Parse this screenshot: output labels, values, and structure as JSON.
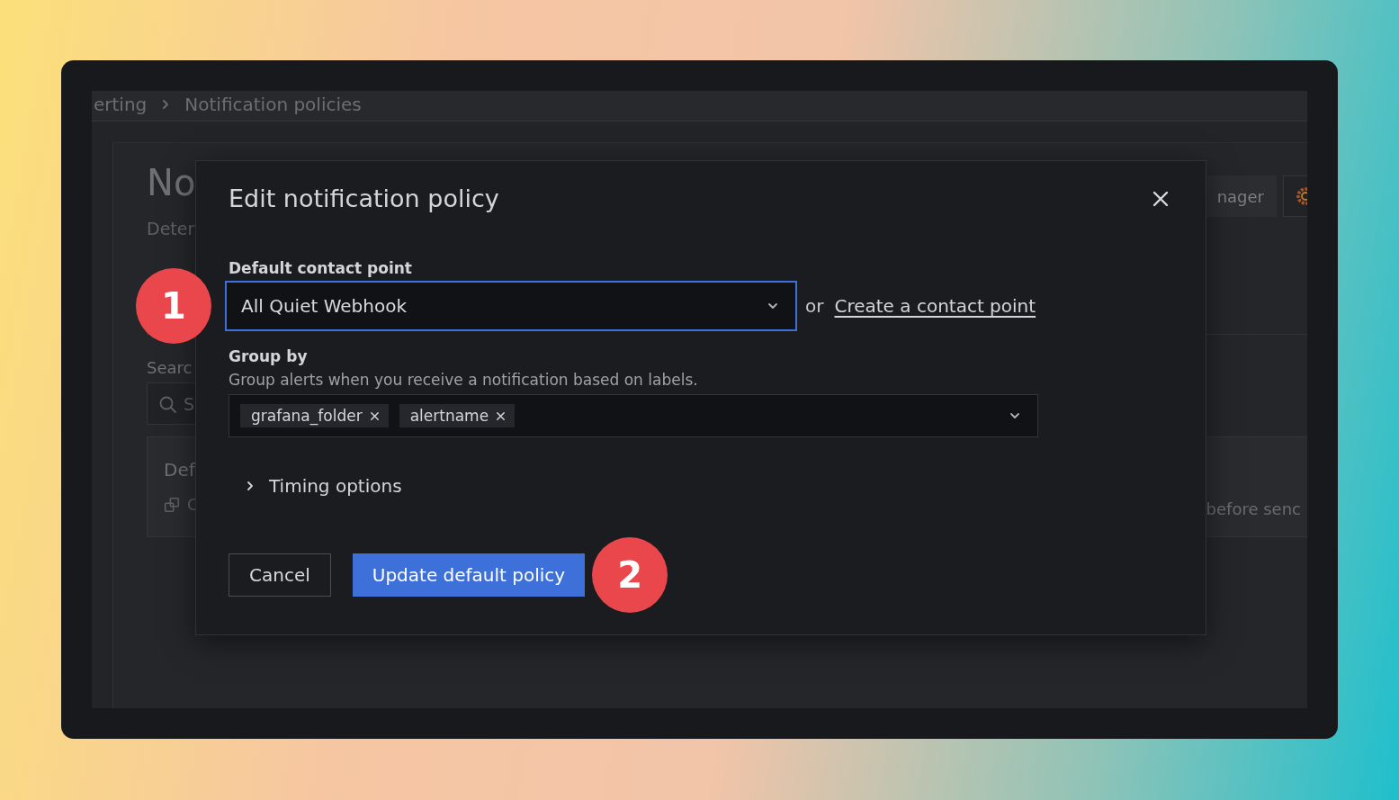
{
  "breadcrumb": [
    {
      "label": "erting"
    },
    {
      "label": "Notification policies"
    }
  ],
  "background_page": {
    "title": "No",
    "subtitle": "Deter",
    "search_label": "Searc",
    "search_placeholder": "S",
    "policy_title": "Def",
    "policy_detail": "C",
    "toolbar_button": "nager",
    "detail_text": "before senc"
  },
  "dialog": {
    "title": "Edit notification policy",
    "default_contact_point": {
      "label": "Default contact point",
      "value": "All Quiet Webhook",
      "focused": true,
      "or_text": "or",
      "link": "Create a contact point"
    },
    "group_by": {
      "label": "Group by",
      "description": "Group alerts when you receive a notification based on labels.",
      "tags": [
        "grafana_folder",
        "alertname"
      ]
    },
    "timing_options": {
      "label": "Timing options",
      "expanded": false
    },
    "buttons": [
      {
        "label": "Cancel",
        "kind": "secondary"
      },
      {
        "label": "Update default policy",
        "kind": "primary"
      }
    ]
  },
  "steps": [
    "1",
    "2"
  ]
}
